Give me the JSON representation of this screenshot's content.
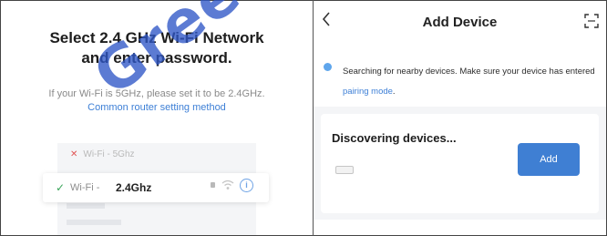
{
  "left_panel": {
    "title_line1": "Select 2.4 GHz Wi-Fi Network",
    "title_line2": "and enter password.",
    "hint": "If your Wi-Fi is 5GHz, please set it to be 2.4GHz.",
    "router_link": "Common router setting method",
    "wifi_list": {
      "row_5g": {
        "status": "unsupported",
        "label": "Wi-Fi - 5Ghz"
      },
      "row_24g": {
        "status": "supported",
        "prefix": "Wi-Fi - ",
        "ssid": "2.4Ghz"
      }
    }
  },
  "right_panel": {
    "title": "Add Device",
    "notice": {
      "text": "Searching for nearby devices. Make sure your device has entered ",
      "link": "pairing mode",
      "suffix": "."
    },
    "discovering": {
      "title": "Discovering devices...",
      "add_button": "Add"
    }
  },
  "watermark": "Gree",
  "colors": {
    "accent": "#3f7fd3",
    "link": "#3d7fd6",
    "success": "#3aa55a",
    "error": "#e05656",
    "panel_bg": "#f4f5f7"
  },
  "icons": [
    "x-mark-icon",
    "check-icon",
    "lock-icon",
    "wifi-signal-icon",
    "info-icon",
    "back-arrow-icon",
    "scan-icon",
    "info-dot-icon",
    "device-icon"
  ]
}
